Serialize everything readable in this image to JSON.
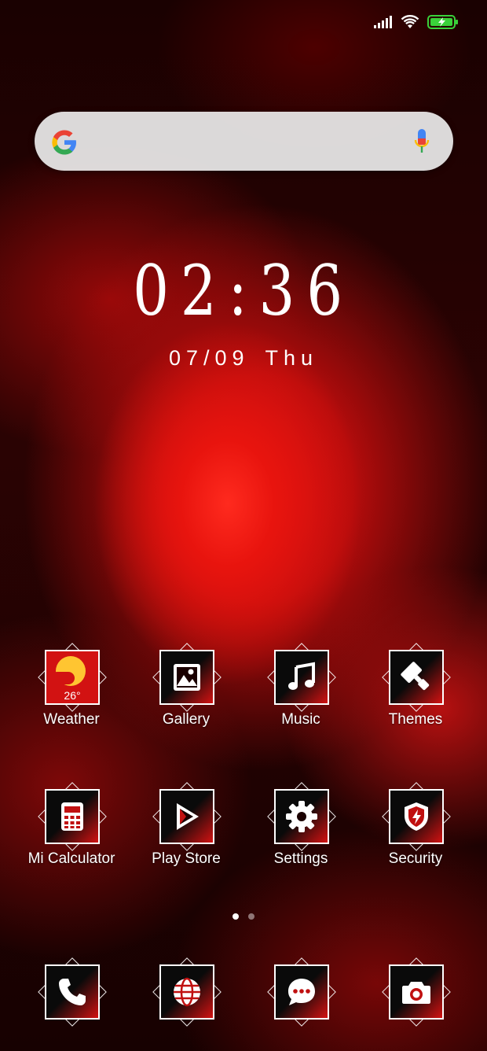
{
  "status_bar": {
    "icons": [
      "signal-icon",
      "wifi-icon",
      "battery-charging-icon"
    ],
    "battery_color": "#3ad13a"
  },
  "search": {
    "logo": "google-logo",
    "mic_icon": "microphone-icon"
  },
  "clock": {
    "time": "02:36",
    "date": "07/09",
    "day": "Thu"
  },
  "apps_row1": [
    {
      "label": "Weather",
      "icon": "weather-icon",
      "temp": "26°"
    },
    {
      "label": "Gallery",
      "icon": "gallery-icon"
    },
    {
      "label": "Music",
      "icon": "music-icon"
    },
    {
      "label": "Themes",
      "icon": "themes-icon"
    }
  ],
  "apps_row2": [
    {
      "label": "Mi Calculator",
      "icon": "calculator-icon"
    },
    {
      "label": "Play Store",
      "icon": "play-store-icon"
    },
    {
      "label": "Settings",
      "icon": "settings-icon"
    },
    {
      "label": "Security",
      "icon": "security-icon"
    }
  ],
  "dock": [
    {
      "icon": "phone-icon"
    },
    {
      "icon": "browser-icon"
    },
    {
      "icon": "messages-icon"
    },
    {
      "icon": "camera-icon"
    }
  ],
  "page_indicator": {
    "current": 1,
    "total": 2
  },
  "colors": {
    "accent": "#d21212",
    "sun": "#ffc531"
  }
}
